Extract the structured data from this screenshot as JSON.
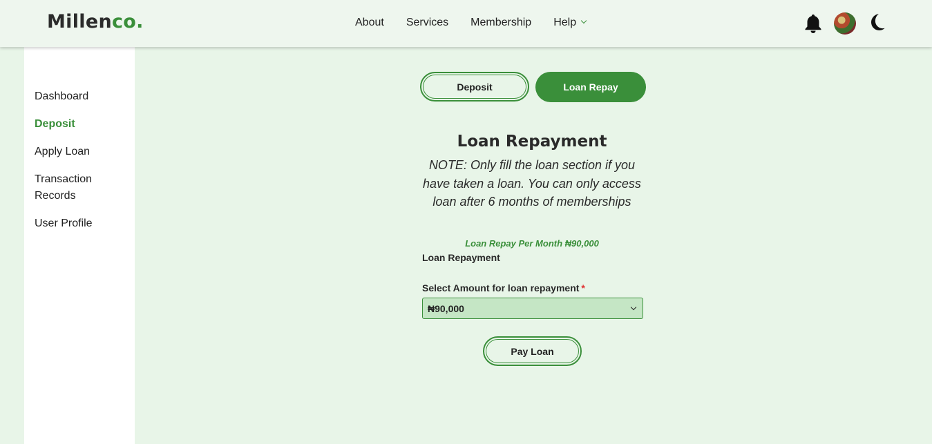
{
  "brand": {
    "logo_part1": "Millen",
    "logo_part2": "co."
  },
  "nav": {
    "about": "About",
    "services": "Services",
    "membership": "Membership",
    "help": "Help"
  },
  "header_icons": [
    "bell-icon",
    "avatar",
    "moon-icon"
  ],
  "sidebar": {
    "items": [
      {
        "label": "Dashboard",
        "active": false
      },
      {
        "label": "Deposit",
        "active": true
      },
      {
        "label": "Apply Loan",
        "active": false
      },
      {
        "label": "Transaction Records",
        "active": false
      },
      {
        "label": "User Profile",
        "active": false
      }
    ]
  },
  "tabs": {
    "deposit": "Deposit",
    "loan_repay": "Loan Repay"
  },
  "main": {
    "title": "Loan Repayment",
    "note": "NOTE: Only fill the loan section if you have taken a loan. You can only access loan after 6 months of memberships",
    "repay_info": "Loan Repay Per Month ₦90,000",
    "section_label": "Loan Repayment",
    "select_label": "Select Amount for loan repayment",
    "required_mark": "*",
    "select_value": "₦90,000",
    "pay_button": "Pay Loan"
  },
  "colors": {
    "accent": "#3a8f3a",
    "background": "#e8f5e8",
    "required": "#e03030"
  }
}
